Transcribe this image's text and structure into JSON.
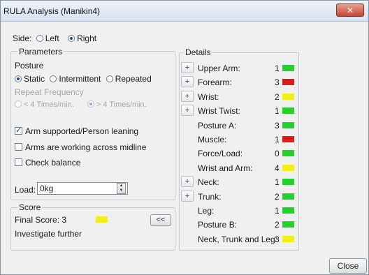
{
  "window": {
    "title": "RULA Analysis (Manikin4)",
    "close_glyph": "✕"
  },
  "side": {
    "label": "Side:",
    "options": [
      "Left",
      "Right"
    ],
    "selected": "Right"
  },
  "parameters": {
    "title": "Parameters",
    "posture_label": "Posture",
    "posture_options": [
      "Static",
      "Intermittent",
      "Repeated"
    ],
    "posture_selected": "Static",
    "repeat_label": "Repeat Frequency",
    "repeat_options": [
      "< 4 Times/min.",
      "> 4 Times/min."
    ],
    "repeat_selected": "> 4 Times/min.",
    "checkboxes": [
      {
        "label": "Arm supported/Person leaning",
        "checked": true
      },
      {
        "label": "Arms are working across midline",
        "checked": false
      },
      {
        "label": "Check balance",
        "checked": false
      }
    ],
    "load_label": "Load:",
    "load_value": "0kg"
  },
  "score": {
    "title": "Score",
    "final_label": "Final Score: 3",
    "final_color": "#f2ee16",
    "collapse_label": "<<",
    "message": "Investigate further"
  },
  "details": {
    "title": "Details",
    "rows": [
      {
        "label": "Upper Arm:",
        "value": "1",
        "color": "#23d12b",
        "expandable": true
      },
      {
        "label": "Forearm:",
        "value": "3",
        "color": "#e0191b",
        "expandable": true
      },
      {
        "label": "Wrist:",
        "value": "2",
        "color": "#f2ee16",
        "expandable": true
      },
      {
        "label": "Wrist Twist:",
        "value": "1",
        "color": "#23d12b",
        "expandable": true
      },
      {
        "label": "Posture A:",
        "value": "3",
        "color": "#23d12b",
        "expandable": false
      },
      {
        "label": "Muscle:",
        "value": "1",
        "color": "#e0191b",
        "expandable": false
      },
      {
        "label": "Force/Load:",
        "value": "0",
        "color": "#23d12b",
        "expandable": false
      },
      {
        "label": "Wrist and Arm:",
        "value": "4",
        "color": "#f2ee16",
        "expandable": false
      },
      {
        "label": "Neck:",
        "value": "1",
        "color": "#23d12b",
        "expandable": true
      },
      {
        "label": "Trunk:",
        "value": "2",
        "color": "#23d12b",
        "expandable": true
      },
      {
        "label": "Leg:",
        "value": "1",
        "color": "#23d12b",
        "expandable": false
      },
      {
        "label": "Posture B:",
        "value": "2",
        "color": "#23d12b",
        "expandable": false
      },
      {
        "label": "Neck, Trunk and Leg:",
        "value": "3",
        "color": "#f2ee16",
        "expandable": false
      }
    ],
    "plus_glyph": "+"
  },
  "footer": {
    "close_label": "Close"
  }
}
